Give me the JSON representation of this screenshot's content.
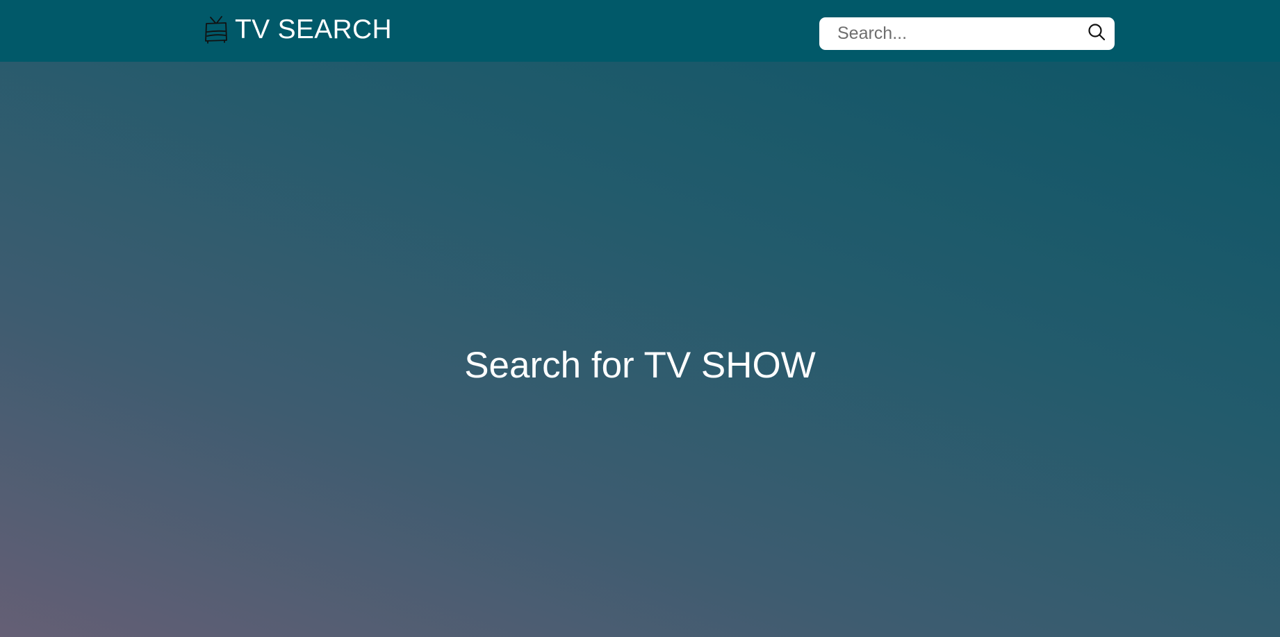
{
  "header": {
    "brand": {
      "icon": "tv-icon",
      "title": "TV SEARCH"
    },
    "search": {
      "placeholder": "Search...",
      "value": "",
      "icon": "search-icon"
    }
  },
  "main": {
    "heading": "Search for TV SHOW"
  },
  "colors": {
    "header_bg": "#015969",
    "gradient_top": "#0a5566",
    "gradient_bottom": "#655f75",
    "text": "#ffffff"
  }
}
